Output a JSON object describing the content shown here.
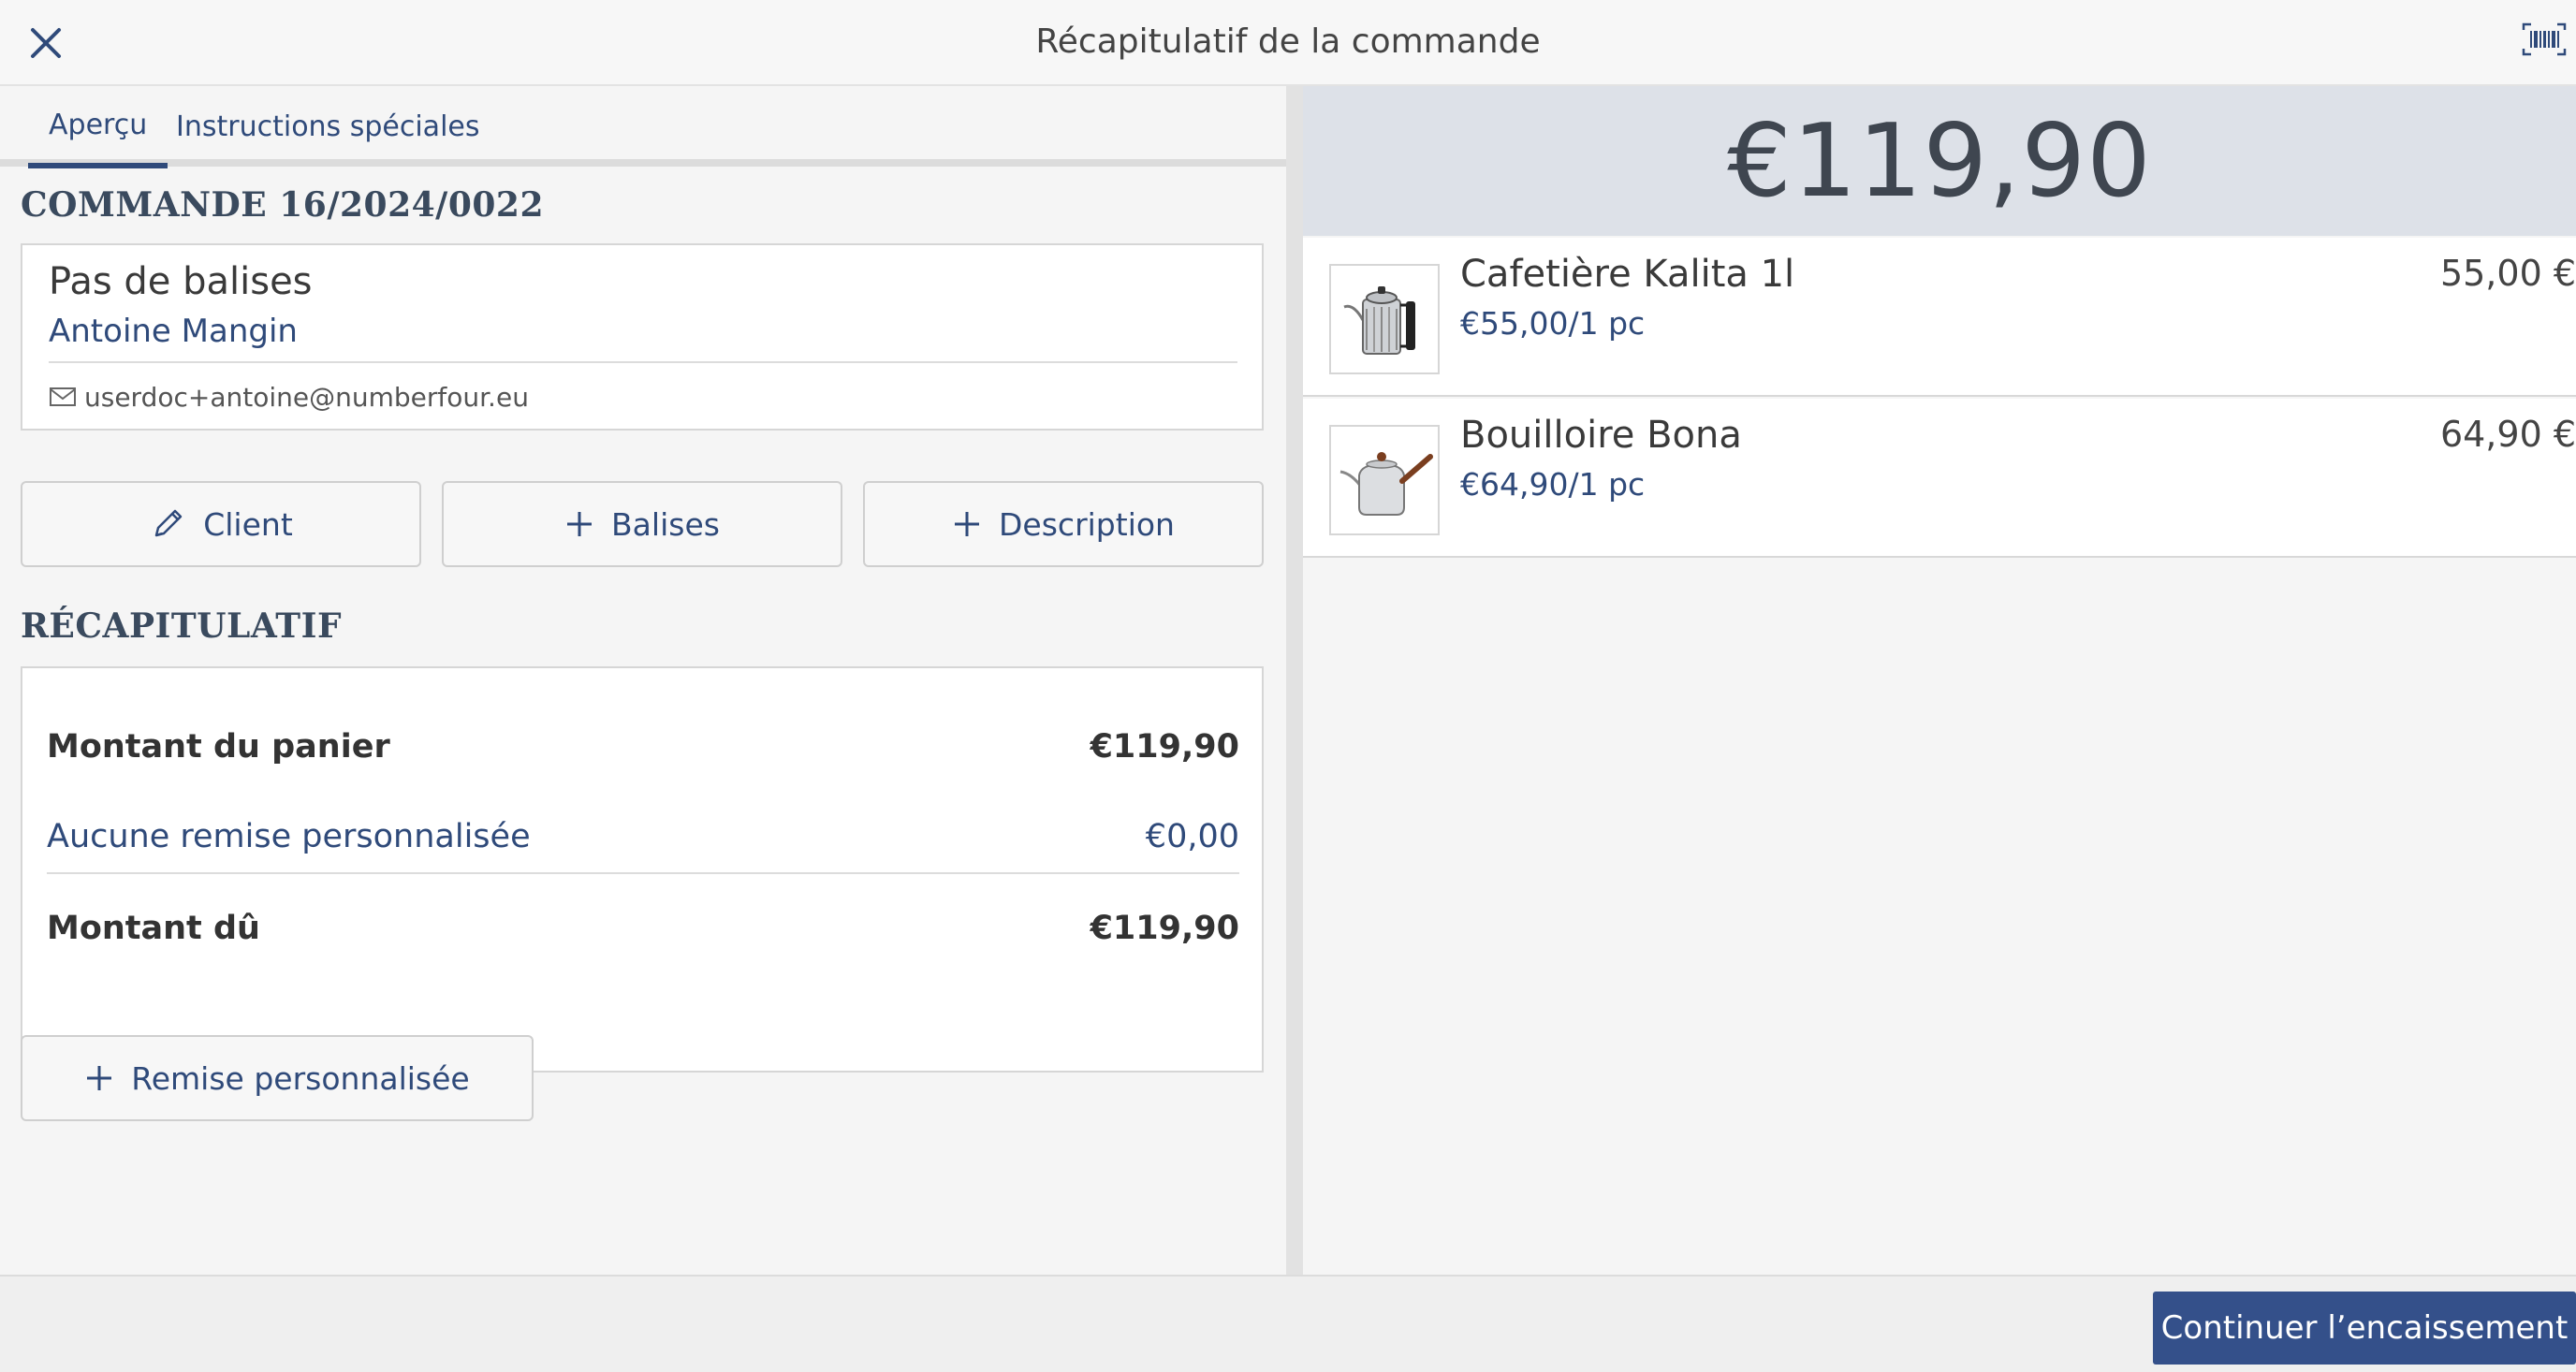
{
  "header": {
    "title": "Récapitulatif de la commande",
    "close_icon": "close-icon",
    "barcode_icon": "barcode-scanner-icon"
  },
  "tabs": [
    {
      "label": "Aperçu",
      "active": true
    },
    {
      "label": "Instructions spéciales",
      "active": false
    }
  ],
  "order": {
    "title": "COMMANDE 16/2024/0022",
    "tags_label": "Pas de balises",
    "customer_name": "Antoine Mangin",
    "customer_email": "userdoc+antoine@numberfour.eu"
  },
  "actions": {
    "client_label": "Client",
    "tags_label": "Balises",
    "description_label": "Description"
  },
  "summary": {
    "title": "RÉCAPITULATIF",
    "basket_label": "Montant du panier",
    "basket_value": "€119,90",
    "discount_label": "Aucune remise personnalisée",
    "discount_value": "€0,00",
    "due_label": "Montant dû",
    "due_value": "€119,90",
    "add_discount_label": "Remise personnalisée"
  },
  "cart": {
    "total": "€119,90",
    "items": [
      {
        "name": "Cafetière Kalita 1l",
        "unit_price": "€55,00/1 pc",
        "price": "55,00 €"
      },
      {
        "name": "Bouilloire Bona",
        "unit_price": "€64,90/1 pc",
        "price": "64,90 €"
      }
    ]
  },
  "footer": {
    "continue_label": "Continuer l’encaissement"
  },
  "colors": {
    "accent": "#2f4a7a",
    "primary_button": "#34508a",
    "total_banner": "#dde1e8"
  }
}
